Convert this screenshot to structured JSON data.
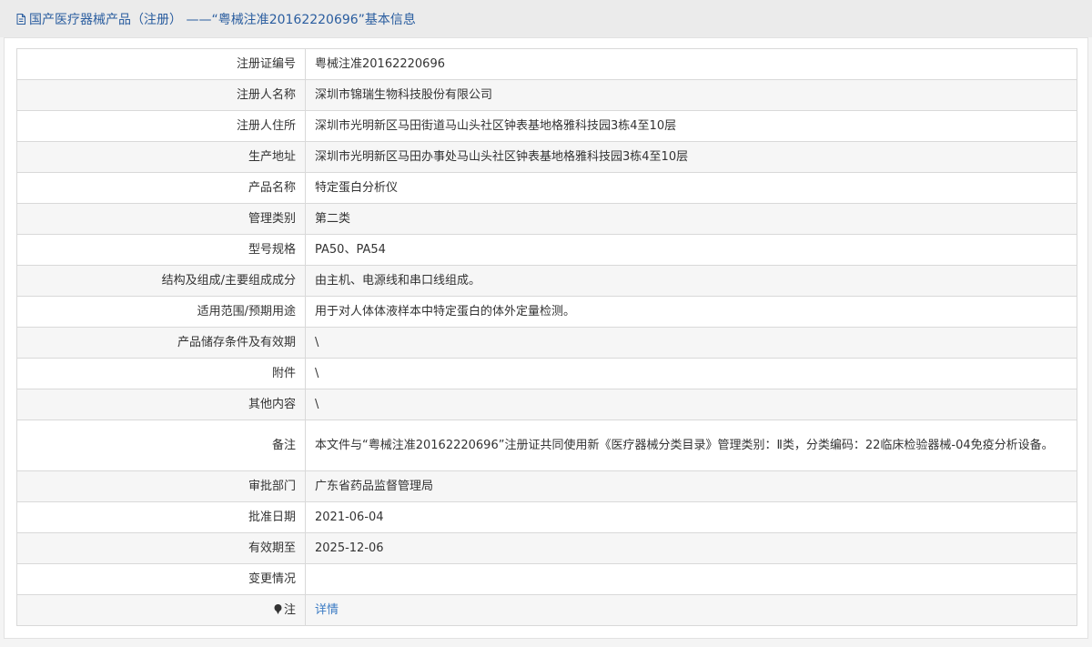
{
  "header": {
    "title": "国产医疗器械产品（注册） ——“粤械注准20162220696”基本信息",
    "icon": "document-icon"
  },
  "rows": [
    {
      "label": "注册证编号",
      "value": "粤械注准20162220696"
    },
    {
      "label": "注册人名称",
      "value": "深圳市锦瑞生物科技股份有限公司"
    },
    {
      "label": "注册人住所",
      "value": "深圳市光明新区马田街道马山头社区钟表基地格雅科技园3栋4至10层"
    },
    {
      "label": "生产地址",
      "value": "深圳市光明新区马田办事处马山头社区钟表基地格雅科技园3栋4至10层"
    },
    {
      "label": "产品名称",
      "value": "特定蛋白分析仪"
    },
    {
      "label": "管理类别",
      "value": "第二类"
    },
    {
      "label": "型号规格",
      "value": "PA50、PA54"
    },
    {
      "label": "结构及组成/主要组成成分",
      "value": "由主机、电源线和串口线组成。"
    },
    {
      "label": "适用范围/预期用途",
      "value": "用于对人体体液样本中特定蛋白的体外定量检测。"
    },
    {
      "label": "产品储存条件及有效期",
      "value": "\\"
    },
    {
      "label": "附件",
      "value": "\\"
    },
    {
      "label": "其他内容",
      "value": "\\"
    },
    {
      "label": "备注",
      "value": "本文件与“粤械注准20162220696”注册证共同使用新《医疗器械分类目录》管理类别：Ⅱ类，分类编码：22临床检验器械-04免疫分析设备。"
    },
    {
      "label": "审批部门",
      "value": "广东省药品监督管理局"
    },
    {
      "label": "批准日期",
      "value": "2021-06-04"
    },
    {
      "label": "有效期至",
      "value": "2025-12-06"
    },
    {
      "label": "变更情况",
      "value": ""
    }
  ],
  "note": {
    "label": "注",
    "icon": "pin-icon",
    "link_text": "详情"
  },
  "colors": {
    "title": "#2a5d9f",
    "link": "#3b7bc4",
    "border": "#d9d9d9",
    "row_alt": "#f6f6f6"
  }
}
